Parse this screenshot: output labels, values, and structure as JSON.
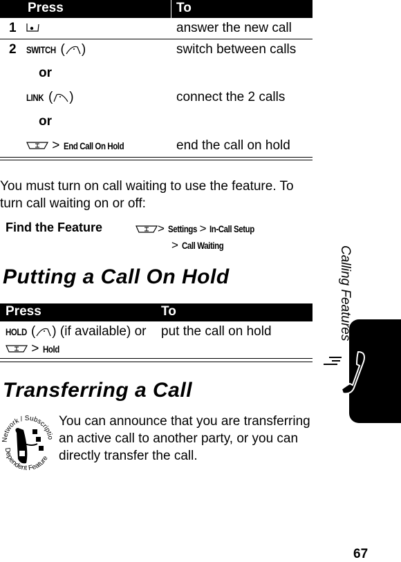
{
  "table1": {
    "headers": {
      "press": "Press",
      "to": "To"
    },
    "rows": [
      {
        "num": "1",
        "press_icon": "send-key-icon",
        "to": "answer the new call"
      },
      {
        "num": "2",
        "press_softkey": "SWITCH",
        "press_icon": "left-soft-key-icon",
        "to": "switch between calls"
      },
      {
        "or1": "or"
      },
      {
        "press_softkey": "LINK",
        "press_icon": "left-soft-key-icon",
        "to": "connect the 2 calls"
      },
      {
        "or2": "or"
      },
      {
        "press_icon": "menu-key-icon",
        "sep": ">",
        "press_menu": "End Call On Hold",
        "to": "end the call on hold"
      }
    ]
  },
  "intro": "You must turn on call waiting to use the feature. To turn call waiting on or off:",
  "find_feature": {
    "label": "Find the Feature",
    "sep": ">",
    "path1": "Settings",
    "path2": "In-Call Setup",
    "path3": "Call Waiting"
  },
  "section_hold": {
    "title": "Putting a Call On Hold",
    "headers": {
      "press": "Press",
      "to": "To"
    },
    "press_softkey": "HOLD",
    "press_text": "(if available) or",
    "sep": ">",
    "press_menu": "Hold",
    "to": "put the call on hold"
  },
  "section_transfer": {
    "title": "Transferring a Call",
    "badge_top": "Network / Subscription",
    "badge_bottom": "Dependent Feature",
    "body": "You can announce that you are transferring an active call to another party, or you can directly transfer the call."
  },
  "side": {
    "chapter": "Calling Features"
  },
  "page_number": "67"
}
